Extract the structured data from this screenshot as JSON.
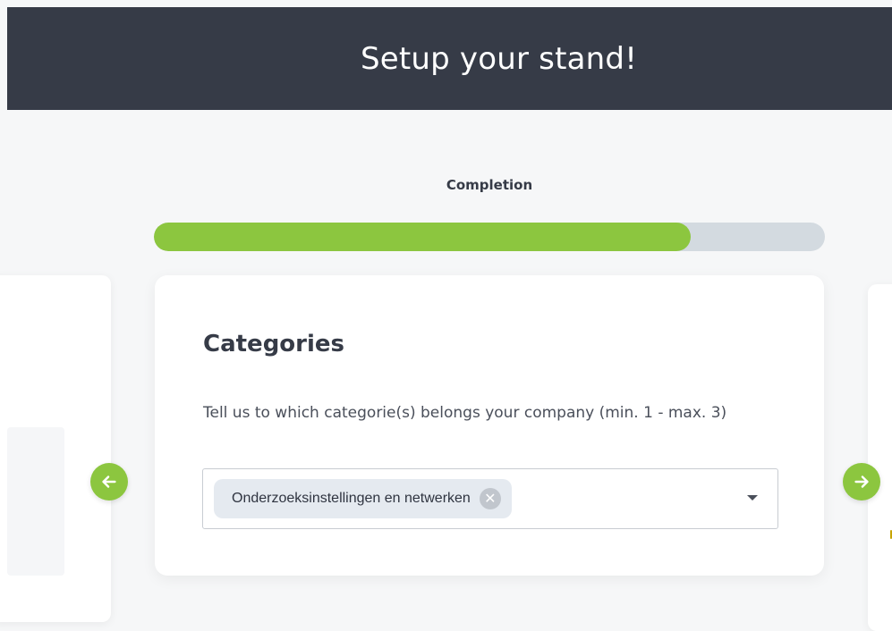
{
  "header": {
    "title": "Setup your stand!"
  },
  "progress": {
    "label": "Completion",
    "percent": 80
  },
  "card": {
    "title": "Categories",
    "description": "Tell us to which categorie(s) belongs your company (min. 1 - max. 3)",
    "select": {
      "selected": [
        "Onderzoeksinstellingen en netwerken"
      ]
    }
  },
  "nav": {
    "prev_icon": "arrow-left-icon",
    "next_icon": "arrow-right-icon"
  },
  "colors": {
    "header_bg": "#363b47",
    "accent": "#8cc63f",
    "track": "#d3dae0"
  }
}
